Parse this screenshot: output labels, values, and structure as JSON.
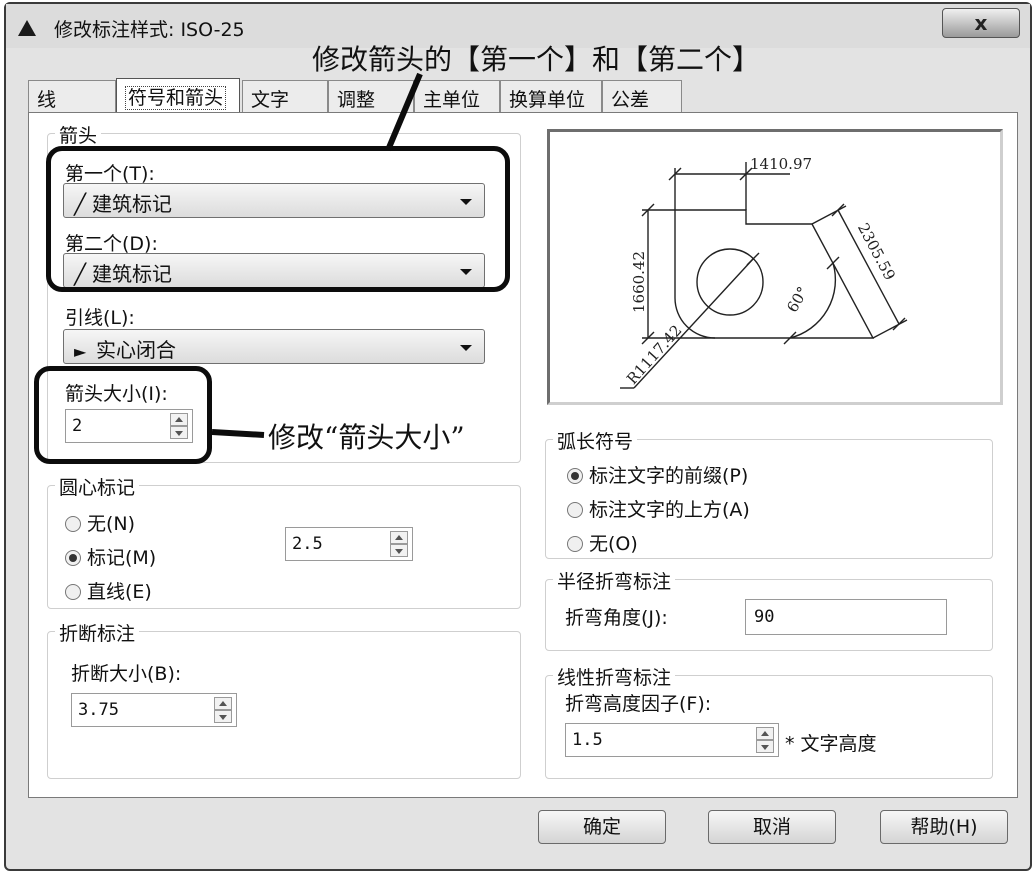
{
  "window": {
    "title": "修改标注样式: ISO-25",
    "close_label": "x"
  },
  "annotations": {
    "top": "修改箭头的【第一个】和【第二个】",
    "size": "修改“箭头大小”"
  },
  "tabs": [
    "线",
    "符号和箭头",
    "文字",
    "调整",
    "主单位",
    "换算单位",
    "公差"
  ],
  "active_tab": "符号和箭头",
  "arrows": {
    "group_title": "箭头",
    "first_label": "第一个(T):",
    "first_value": "建筑标记",
    "second_label": "第二个(D):",
    "second_value": "建筑标记",
    "leader_label": "引线(L):",
    "leader_value": "实心闭合",
    "size_label": "箭头大小(I):",
    "size_value": "2"
  },
  "center_marks": {
    "group_title": "圆心标记",
    "options": [
      "无(N)",
      "标记(M)",
      "直线(E)"
    ],
    "selected": "标记(M)",
    "value": "2.5"
  },
  "break": {
    "group_title": "折断标注",
    "size_label": "折断大小(B):",
    "size_value": "3.75"
  },
  "preview": {
    "dim_top": "1410.97",
    "dim_left": "1660.42",
    "dim_diag": "2305.59",
    "dim_angle": "60°",
    "dim_radius": "R1117.42"
  },
  "arc_symbol": {
    "group_title": "弧长符号",
    "options": [
      "标注文字的前缀(P)",
      "标注文字的上方(A)",
      "无(O)"
    ],
    "selected": "标注文字的前缀(P)"
  },
  "radius_jog": {
    "group_title": "半径折弯标注",
    "angle_label": "折弯角度(J):",
    "angle_value": "90"
  },
  "linear_jog": {
    "group_title": "线性折弯标注",
    "factor_label": "折弯高度因子(F):",
    "factor_value": "1.5",
    "suffix": "* 文字高度"
  },
  "buttons": {
    "ok": "确定",
    "cancel": "取消",
    "help": "帮助(H)"
  }
}
